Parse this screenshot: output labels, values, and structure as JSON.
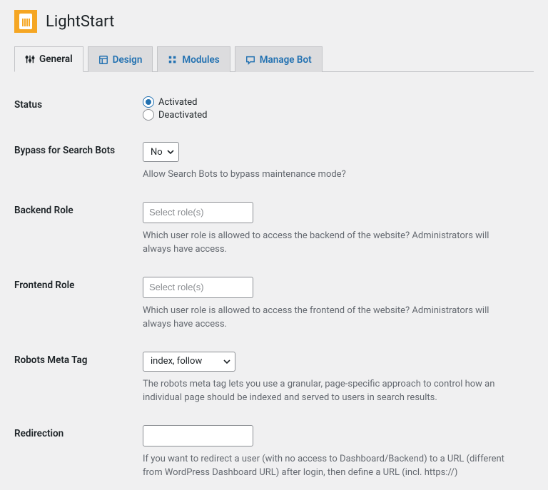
{
  "header": {
    "title": "LightStart"
  },
  "tabs": {
    "general": "General",
    "design": "Design",
    "modules": "Modules",
    "manage_bot": "Manage Bot"
  },
  "fields": {
    "status": {
      "label": "Status",
      "activated": "Activated",
      "deactivated": "Deactivated"
    },
    "bypass": {
      "label": "Bypass for Search Bots",
      "value": "No",
      "description": "Allow Search Bots to bypass maintenance mode?"
    },
    "backend_role": {
      "label": "Backend Role",
      "placeholder": "Select role(s)",
      "description": "Which user role is allowed to access the backend of the website? Administrators will always have access."
    },
    "frontend_role": {
      "label": "Frontend Role",
      "placeholder": "Select role(s)",
      "description": "Which user role is allowed to access the frontend of the website? Administrators will always have access."
    },
    "robots": {
      "label": "Robots Meta Tag",
      "value": "index, follow",
      "description": "The robots meta tag lets you use a granular, page-specific approach to control how an individual page should be indexed and served to users in search results."
    },
    "redirection": {
      "label": "Redirection",
      "value": "",
      "description": "If you want to redirect a user (with no access to Dashboard/Backend) to a URL (different from WordPress Dashboard URL) after login, then define a URL (incl. https://)"
    }
  }
}
